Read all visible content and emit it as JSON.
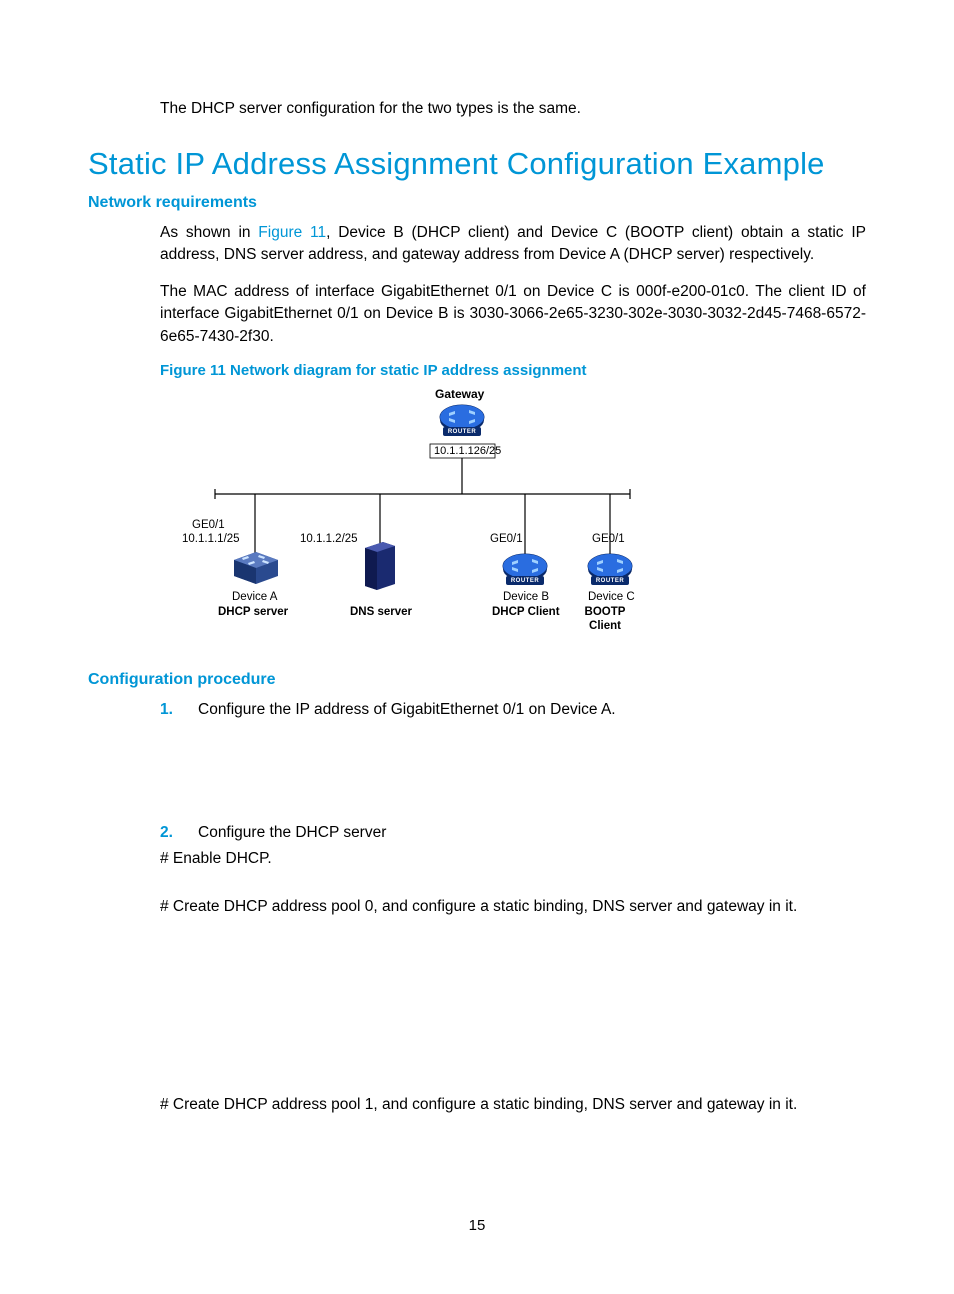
{
  "intro": "The DHCP server configuration for the two types is the same.",
  "h1": "Static IP Address Assignment Configuration Example",
  "sec1": {
    "title": "Network requirements",
    "p1_a": "As shown in ",
    "p1_link": "Figure 11",
    "p1_b": ", Device B (DHCP client) and Device C (BOOTP client) obtain a static IP address, DNS server address, and gateway address from Device A (DHCP server) respectively.",
    "p2": "The MAC address of interface GigabitEthernet 0/1 on Device C is 000f-e200-01c0. The client ID of interface GigabitEthernet 0/1 on Device B is 3030-3066-2e65-3230-302e-3030-3032-2d45-7468-6572-6e65-7430-2f30.",
    "figcap": "Figure 11 Network diagram for static IP address assignment"
  },
  "diagram": {
    "gateway": "Gateway",
    "gateway_ip": "10.1.1.126/25",
    "devA_port": "GE0/1",
    "devA_ip": "10.1.1.1/25",
    "devA_name": "Device A",
    "devA_role": "DHCP server",
    "dns_ip": "10.1.1.2/25",
    "dns_role": "DNS server",
    "devB_port": "GE0/1",
    "devB_name": "Device B",
    "devB_role": "DHCP Client",
    "devC_port": "GE0/1",
    "devC_name": "Device C",
    "devC_role": "BOOTP Client",
    "router_tag": "ROUTER"
  },
  "sec2": {
    "title": "Configuration procedure",
    "step1_num": "1.",
    "step1": "Configure the IP address of GigabitEthernet 0/1 on Device A.",
    "step2_num": "2.",
    "step2": "Configure the DHCP server",
    "hash1": "# Enable DHCP.",
    "hash2": "# Create DHCP address pool 0, and configure a static binding, DNS server and gateway in it.",
    "hash3": "# Create DHCP address pool 1, and configure a static binding, DNS server and gateway in it."
  },
  "page_num": "15"
}
